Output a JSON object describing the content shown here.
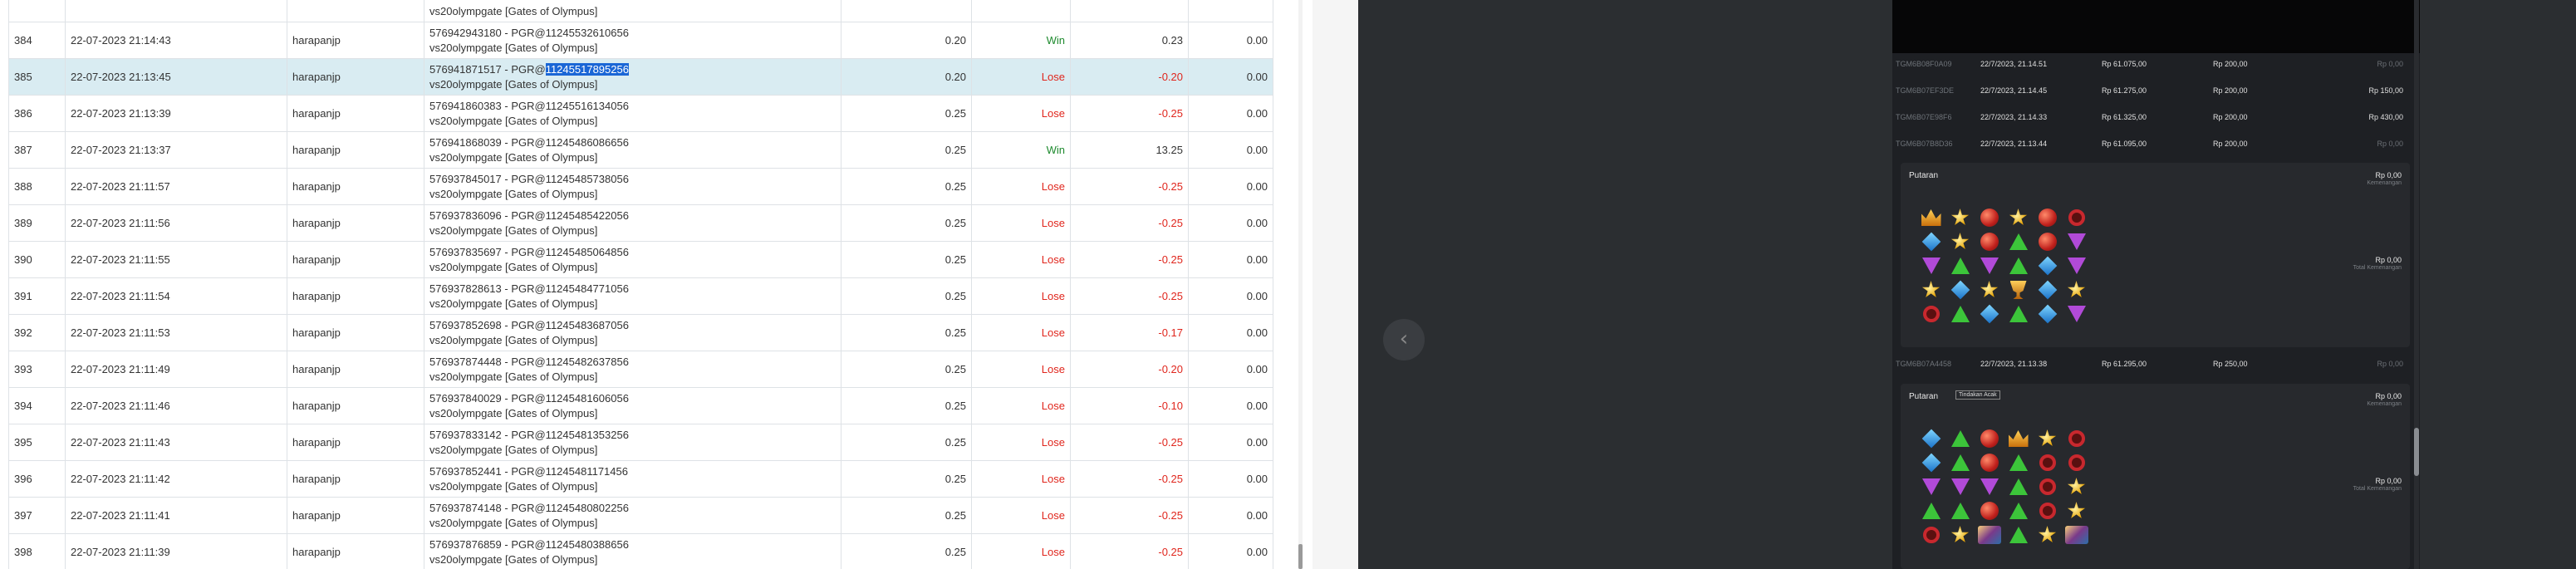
{
  "colors": {
    "win": "#1e8a2e",
    "lose": "#e0261d",
    "selected_row": "#d9ecf2",
    "text_highlight": "#1a66d6",
    "dark_panel": "#1e2024"
  },
  "transactions": {
    "top_partial_desc": "vs20olympgate [Gates of Olympus]",
    "rows": [
      {
        "no": "384",
        "date": "22-07-2023 21:14:43",
        "user": "harapanjp",
        "desc_line1": "576942943180 - PGR@11245532610656",
        "desc_line2": "vs20olympgate [Gates of Olympus]",
        "bet": "0.20",
        "result": "Win",
        "winloss": "0.23",
        "balance": "0.00"
      },
      {
        "no": "385",
        "date": "22-07-2023 21:13:45",
        "user": "harapanjp",
        "desc_line1": "576941871517 - PGR@",
        "desc_highlight": "11245517895256",
        "desc_line2": "vs20olympgate [Gates of Olympus]",
        "bet": "0.20",
        "result": "Lose",
        "winloss": "-0.20",
        "balance": "0.00",
        "selected": true
      },
      {
        "no": "386",
        "date": "22-07-2023 21:13:39",
        "user": "harapanjp",
        "desc_line1": "576941860383 - PGR@11245516134056",
        "desc_line2": "vs20olympgate [Gates of Olympus]",
        "bet": "0.25",
        "result": "Lose",
        "winloss": "-0.25",
        "balance": "0.00"
      },
      {
        "no": "387",
        "date": "22-07-2023 21:13:37",
        "user": "harapanjp",
        "desc_line1": "576941868039 - PGR@11245486086656",
        "desc_line2": "vs20olympgate [Gates of Olympus]",
        "bet": "0.25",
        "result": "Win",
        "winloss": "13.25",
        "balance": "0.00"
      },
      {
        "no": "388",
        "date": "22-07-2023 21:11:57",
        "user": "harapanjp",
        "desc_line1": "576937845017 - PGR@11245485738056",
        "desc_line2": "vs20olympgate [Gates of Olympus]",
        "bet": "0.25",
        "result": "Lose",
        "winloss": "-0.25",
        "balance": "0.00"
      },
      {
        "no": "389",
        "date": "22-07-2023 21:11:56",
        "user": "harapanjp",
        "desc_line1": "576937836096 - PGR@11245485422056",
        "desc_line2": "vs20olympgate [Gates of Olympus]",
        "bet": "0.25",
        "result": "Lose",
        "winloss": "-0.25",
        "balance": "0.00"
      },
      {
        "no": "390",
        "date": "22-07-2023 21:11:55",
        "user": "harapanjp",
        "desc_line1": "576937835697 - PGR@11245485064856",
        "desc_line2": "vs20olympgate [Gates of Olympus]",
        "bet": "0.25",
        "result": "Lose",
        "winloss": "-0.25",
        "balance": "0.00"
      },
      {
        "no": "391",
        "date": "22-07-2023 21:11:54",
        "user": "harapanjp",
        "desc_line1": "576937828613 - PGR@11245484771056",
        "desc_line2": "vs20olympgate [Gates of Olympus]",
        "bet": "0.25",
        "result": "Lose",
        "winloss": "-0.25",
        "balance": "0.00"
      },
      {
        "no": "392",
        "date": "22-07-2023 21:11:53",
        "user": "harapanjp",
        "desc_line1": "576937852698 - PGR@11245483687056",
        "desc_line2": "vs20olympgate [Gates of Olympus]",
        "bet": "0.25",
        "result": "Lose",
        "winloss": "-0.17",
        "balance": "0.00"
      },
      {
        "no": "393",
        "date": "22-07-2023 21:11:49",
        "user": "harapanjp",
        "desc_line1": "576937874448 - PGR@11245482637856",
        "desc_line2": "vs20olympgate [Gates of Olympus]",
        "bet": "0.25",
        "result": "Lose",
        "winloss": "-0.20",
        "balance": "0.00"
      },
      {
        "no": "394",
        "date": "22-07-2023 21:11:46",
        "user": "harapanjp",
        "desc_line1": "576937840029 - PGR@11245481606056",
        "desc_line2": "vs20olympgate [Gates of Olympus]",
        "bet": "0.25",
        "result": "Lose",
        "winloss": "-0.10",
        "balance": "0.00"
      },
      {
        "no": "395",
        "date": "22-07-2023 21:11:43",
        "user": "harapanjp",
        "desc_line1": "576937833142 - PGR@11245481353256",
        "desc_line2": "vs20olympgate [Gates of Olympus]",
        "bet": "0.25",
        "result": "Lose",
        "winloss": "-0.25",
        "balance": "0.00"
      },
      {
        "no": "396",
        "date": "22-07-2023 21:11:42",
        "user": "harapanjp",
        "desc_line1": "576937852441 - PGR@11245481171456",
        "desc_line2": "vs20olympgate [Gates of Olympus]",
        "bet": "0.25",
        "result": "Lose",
        "winloss": "-0.25",
        "balance": "0.00"
      },
      {
        "no": "397",
        "date": "22-07-2023 21:11:41",
        "user": "harapanjp",
        "desc_line1": "576937874148 - PGR@11245480802256",
        "desc_line2": "vs20olympgate [Gates of Olympus]",
        "bet": "0.25",
        "result": "Lose",
        "winloss": "-0.25",
        "balance": "0.00"
      },
      {
        "no": "398",
        "date": "22-07-2023 21:11:39",
        "user": "harapanjp",
        "desc_line1": "576937876859 - PGR@11245480388656",
        "desc_line2": "vs20olympgate [Gates of Olympus]",
        "bet": "0.25",
        "result": "Lose",
        "winloss": "-0.25",
        "balance": "0.00"
      }
    ]
  },
  "extensions": {
    "icons": [
      "tag-icon",
      "toolbox-icon",
      "person-icon",
      "circle-icon",
      "outlook-icon",
      "cart-icon",
      "plus-icon"
    ]
  },
  "right_pane": {
    "back_glyph": "‹"
  },
  "game_history": {
    "rows_top": [
      {
        "id": "TGM6B08F0A09",
        "date": "22/7/2023, 21.14.51",
        "balance": "Rp 61.075,00",
        "bet": "Rp 200,00",
        "win": "Rp 0,00",
        "win_dim": true
      },
      {
        "id": "TGM6B07EF3DE",
        "date": "22/7/2023, 21.14.45",
        "balance": "Rp 61.275,00",
        "bet": "Rp 200,00",
        "win": "Rp 150,00",
        "win_dim": false
      },
      {
        "id": "TGM6B07E98F6",
        "date": "22/7/2023, 21.14.33",
        "balance": "Rp 61.325,00",
        "bet": "Rp 200,00",
        "win": "Rp 430,00",
        "win_dim": false
      },
      {
        "id": "TGM6B07B8D36",
        "date": "22/7/2023, 21.13.44",
        "balance": "Rp 61.095,00",
        "bet": "Rp 200,00",
        "win": "Rp 0,00",
        "win_dim": true
      }
    ],
    "round1": {
      "title": "Putaran",
      "amount": "Rp 0,00",
      "amount_sub": "Kemenangan",
      "amount2": "Rp 0,00",
      "amount2_sub": "Total Kemenangan",
      "grid": [
        [
          "crown",
          "yellow",
          "red",
          "yellow",
          "red",
          "ring"
        ],
        [
          "blue",
          "yellow",
          "red",
          "green",
          "red",
          "purple"
        ],
        [
          "purple",
          "green",
          "purple",
          "green",
          "blue",
          "purple"
        ],
        [
          "yellow",
          "blue",
          "yellow",
          "cup",
          "blue",
          "yellow"
        ],
        [
          "ring",
          "green",
          "blue",
          "green",
          "blue",
          "purple"
        ]
      ]
    },
    "row_mid": {
      "id": "TGM6B07A4458",
      "date": "22/7/2023, 21.13.38",
      "balance": "Rp 61.295,00",
      "bet": "Rp 250,00",
      "win": "Rp 0,00",
      "win_dim": true
    },
    "round2": {
      "title": "Putaran",
      "badge": "Tindakan Acak",
      "amount": "Rp 0,00",
      "amount_sub": "Kemenangan",
      "amount2": "Rp 0,00",
      "amount2_sub": "Total Kemenangan",
      "grid": [
        [
          "blue",
          "green",
          "red",
          "crown",
          "yellow",
          "ring"
        ],
        [
          "blue",
          "green",
          "red",
          "green",
          "ring",
          "ring"
        ],
        [
          "purple",
          "purple",
          "purple",
          "green",
          "ring",
          "yellow"
        ],
        [
          "green",
          "green",
          "red",
          "green",
          "ring",
          "yellow"
        ],
        [
          "ring",
          "yellow",
          "scatter",
          "green",
          "yellow",
          "scatter"
        ]
      ]
    }
  }
}
